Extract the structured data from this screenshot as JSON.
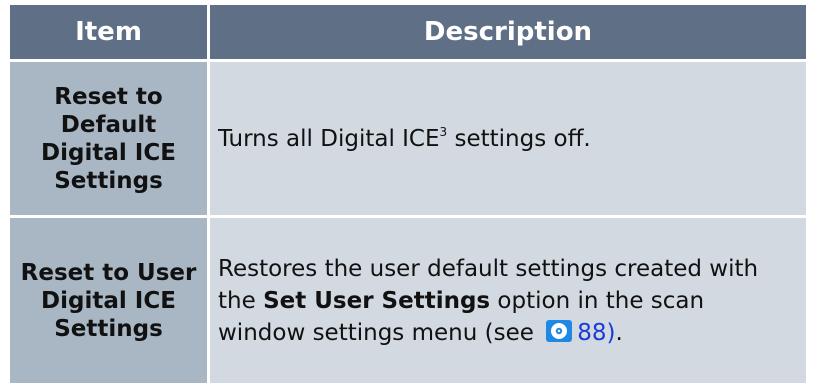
{
  "header": {
    "item": "Item",
    "description": "Description"
  },
  "rows": [
    {
      "item": "Reset to Default Digital ICE Settings",
      "desc_before": "Turns all Digital ICE",
      "desc_sup": "3",
      "desc_after": " settings off."
    },
    {
      "item": "Reset to User Digital ICE Settings",
      "desc_before": "Restores the user default settings created with the ",
      "desc_bold": "Set User Settings",
      "desc_after": " option in the scan window settings menu (see ",
      "page_ref": "88)",
      "desc_end": "."
    }
  ],
  "colors": {
    "header_bg": "#5f6f86",
    "item_bg": "#a9b7c4",
    "desc_bg": "#d2d9e1",
    "link": "#1a3bd6"
  },
  "icons": {
    "page_ref": "cd-rom-reference-icon"
  }
}
